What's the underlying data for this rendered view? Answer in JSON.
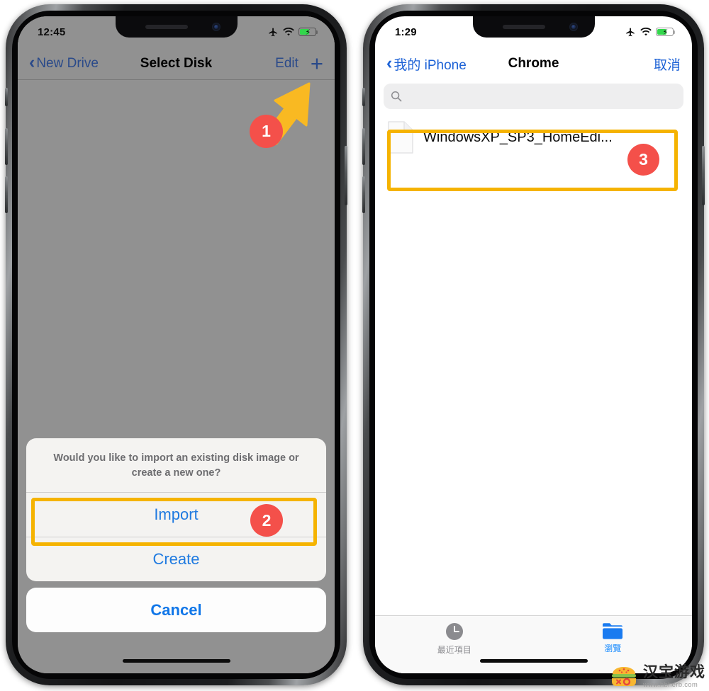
{
  "left_phone": {
    "status": {
      "time": "12:45",
      "icons": [
        "airplane-mode-icon",
        "wifi-icon",
        "battery-charging-icon"
      ]
    },
    "nav": {
      "back_label": "New Drive",
      "title": "Select Disk",
      "edit_label": "Edit",
      "add_label": "+"
    },
    "action_sheet": {
      "message": "Would you like to import an existing disk image or create a new one?",
      "buttons": [
        {
          "label": "Import"
        },
        {
          "label": "Create"
        }
      ],
      "cancel_label": "Cancel"
    }
  },
  "right_phone": {
    "status": {
      "time": "1:29",
      "icons": [
        "airplane-mode-icon",
        "wifi-icon",
        "battery-charging-icon"
      ]
    },
    "nav": {
      "back_label": "我的 iPhone",
      "title": "Chrome",
      "cancel_label": "取消"
    },
    "search": {
      "value": "",
      "placeholder": "",
      "icon": "search-icon"
    },
    "files": [
      {
        "name": "WindowsXP_SP3_HomeEdi...",
        "icon": "document-icon"
      }
    ],
    "tabbar": [
      {
        "label": "最近項目",
        "icon": "clock-icon",
        "active": false
      },
      {
        "label": "瀏覽",
        "icon": "folder-icon",
        "active": true
      }
    ]
  },
  "annotations": {
    "badges": [
      {
        "id": "1",
        "text": "1"
      },
      {
        "id": "2",
        "text": "2"
      },
      {
        "id": "3",
        "text": "3"
      }
    ],
    "cursor": "arrow-cursor",
    "highlight_color": "#f5b301",
    "badge_color": "#f4504a"
  },
  "watermark": {
    "name": "汉宝游戏",
    "url": "www.hbherb.com"
  }
}
